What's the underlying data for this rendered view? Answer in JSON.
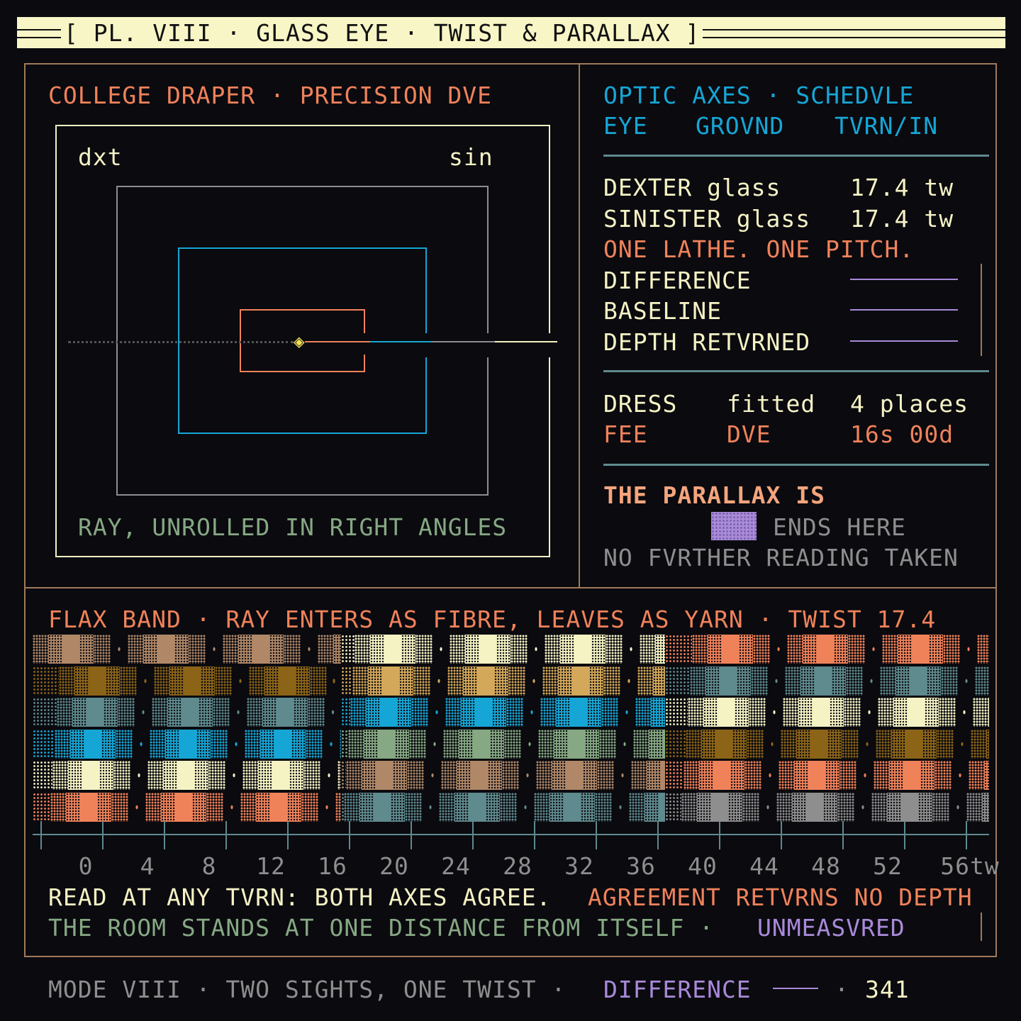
{
  "title": "[ PL. VIII · GLASS EYE · TWIST & PARALLAX ]",
  "diagram": {
    "heading": "COLLEGE DRAPER · PRECISION DVE",
    "label_left": "dxt",
    "label_right": "sin",
    "caption": "RAY, UNROLLED IN RIGHT ANGLES",
    "marker": "◈"
  },
  "schedule": {
    "heading": "OPTIC AXES · SCHEDVLE",
    "columns": [
      "EYE",
      "GROVND",
      "TVRN/IN"
    ],
    "rows": [
      {
        "label": "DEXTER glass",
        "value": "17.4 tw"
      },
      {
        "label": "SINISTER glass",
        "value": "17.4 tw"
      }
    ],
    "note": "ONE LATHE. ONE PITCH.",
    "blanks": [
      "DIFFERENCE",
      "BASELINE",
      "DEPTH RETVRNED"
    ],
    "dress": {
      "label": "DRESS",
      "a": "fitted",
      "b": "4 places"
    },
    "fee": {
      "label": "FEE",
      "a": "DVE",
      "b": "16s 00d"
    },
    "parallax_heading": "THE PARALLAX IS",
    "parallax_end": "ENDS HERE",
    "parallax_note": "NO FVRTHER READING TAKEN"
  },
  "band": {
    "heading": "FLAX BAND · RAY ENTERS AS FIBRE, LEAVES AS YARN · TWIST 17.4",
    "axis_labels": [
      "0",
      "4",
      "8",
      "12",
      "16",
      "20",
      "24",
      "28",
      "32",
      "36",
      "40",
      "44",
      "48",
      "52",
      "56tw"
    ],
    "rows": [
      [
        "#b08868",
        "#f5f2c4",
        "#f0825a"
      ],
      [
        "#8c6418",
        "#d4a85a",
        "#5f8a8e"
      ],
      [
        "#5f8a8e",
        "#16a6d6",
        "#f5f2c4"
      ],
      [
        "#16a6d6",
        "#86a883",
        "#8c6418"
      ],
      [
        "#f5f2c4",
        "#b08868",
        "#f0825a"
      ],
      [
        "#f0825a",
        "#5f8a8e",
        "#8e8e8e"
      ]
    ],
    "line1_a": "READ AT ANY TVRN: BOTH AXES AGREE.",
    "line1_b": "AGREEMENT RETVRNS NO DEPTH",
    "line2_a": "THE ROOM STANDS AT ONE DISTANCE FROM ITSELF ·",
    "line2_b": "UNMEASVRED"
  },
  "footer": {
    "mode": "MODE VIII · TWO SIGHTS, ONE TWIST ·",
    "diff": "DIFFERENCE",
    "sep": "·",
    "number": "341"
  }
}
